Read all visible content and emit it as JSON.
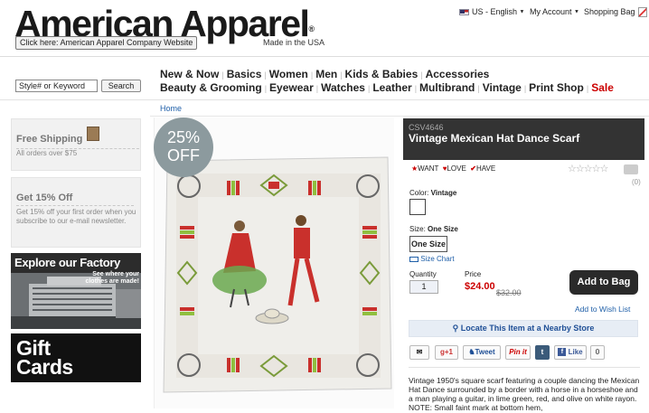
{
  "header": {
    "logo": "American Apparel",
    "logo_mark": "®",
    "company_button": "Click here: American Apparel Company Website",
    "made_in": "Made in the USA",
    "locale": "US - English",
    "account": "My Account",
    "bag": "Shopping Bag",
    "search_placeholder": "Style# or Keyword",
    "search_value": "Style# or Keyword",
    "search_button": "Search"
  },
  "nav": {
    "row1": [
      "New & Now",
      "Basics",
      "Women",
      "Men",
      "Kids & Babies",
      "Accessories"
    ],
    "row2": [
      "Beauty & Grooming",
      "Eyewear",
      "Watches",
      "Leather",
      "Multibrand",
      "Vintage",
      "Print Shop"
    ],
    "sale": "Sale"
  },
  "breadcrumb": "Home",
  "sidebar": {
    "free_shipping_title": "Free Shipping",
    "free_shipping_text": "All orders over $75",
    "discount_title": "Get 15% Off",
    "discount_text": "Get 15% off your first order when you subscribe to our e-mail newsletter.",
    "factory_title": "Explore our Factory",
    "factory_sub": "See where your clothes are made!",
    "gift_cards": "Gift Cards"
  },
  "product": {
    "badge_percent": "25%",
    "badge_off": "OFF",
    "sku": "CSV4646",
    "title": "Vintage Mexican Hat Dance Scarf",
    "want": "WANT",
    "love": "LOVE",
    "have": "HAVE",
    "rating_count": "(0)",
    "color_label": "Color:",
    "color_value": "Vintage",
    "size_label": "Size:",
    "size_value": "One Size",
    "size_option": "One Size",
    "size_chart": "Size Chart",
    "quantity_label": "Quantity",
    "quantity_value": "1",
    "price_label": "Price",
    "price": "$24.00",
    "old_price": "$32.00",
    "add_to_bag": "Add to Bag",
    "wishlist": "Add to Wish List",
    "locate": "Locate This Item at a Nearby Store",
    "description": "Vintage 1950's square scarf featuring a couple dancing the Mexican Hat Dance surrounded by a border with a horse in a horseshoe and a man playing a guitar, in lime green, red, and olive on white rayon. NOTE: Small faint mark at bottom hem,"
  },
  "share": {
    "gplus": "+1",
    "tweet": "Tweet",
    "pinit": "Pin it",
    "tumblr": "t",
    "like": "Like",
    "like_count": "0"
  },
  "colors": {
    "sale_red": "#cc0000",
    "link_blue": "#1f5fa8",
    "dark_bar": "#333333",
    "badge_gray": "#8c9a9e"
  }
}
